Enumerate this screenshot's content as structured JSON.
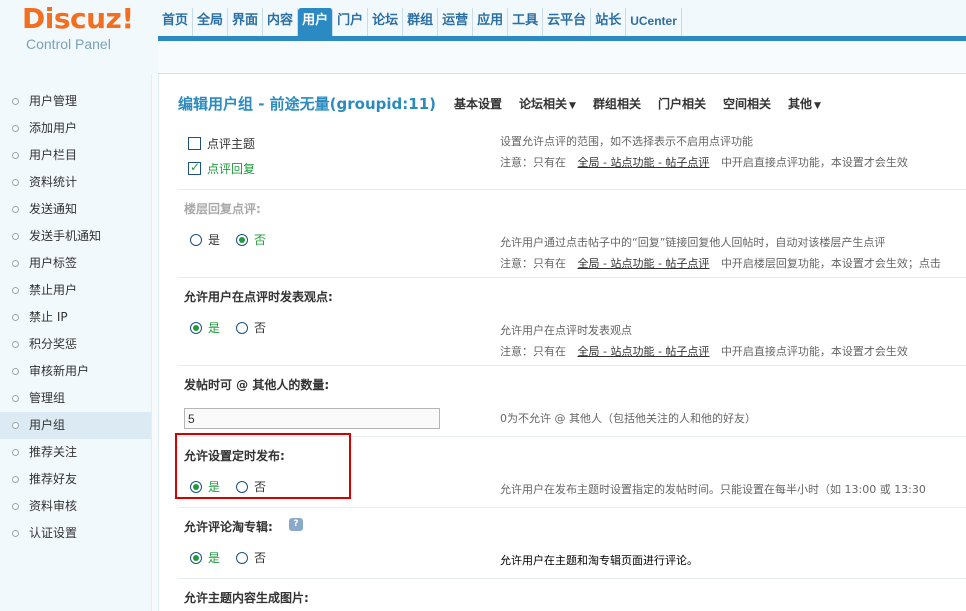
{
  "logo": {
    "brand": "Discuz!",
    "subtitle": "Control Panel"
  },
  "topnav": [
    "首页",
    "全局",
    "界面",
    "内容",
    "用户",
    "门户",
    "论坛",
    "群组",
    "运营",
    "应用",
    "工具",
    "云平台",
    "站长",
    "UCenter"
  ],
  "topnav_active": "用户",
  "sidebar": {
    "items": [
      "用户管理",
      "添加用户",
      "用户栏目",
      "资料统计",
      "发送通知",
      "发送手机通知",
      "用户标签",
      "禁止用户",
      "禁止 IP",
      "积分奖惩",
      "审核新用户",
      "管理组",
      "用户组",
      "推荐关注",
      "推荐好友",
      "资料审核",
      "认证设置"
    ],
    "active": "用户组"
  },
  "page": {
    "title": "编辑用户组 - 前途无量(groupid:11)",
    "tabs": [
      {
        "label": "基本设置",
        "dropdown": false
      },
      {
        "label": "论坛相关",
        "dropdown": true
      },
      {
        "label": "群组相关",
        "dropdown": false
      },
      {
        "label": "门户相关",
        "dropdown": false
      },
      {
        "label": "空间相关",
        "dropdown": false
      },
      {
        "label": "其他",
        "dropdown": true
      }
    ]
  },
  "settings": {
    "comment_scope": {
      "options": [
        {
          "label": "点评主题",
          "checked": false
        },
        {
          "label": "点评回复",
          "checked": true
        }
      ],
      "desc1": "设置允许点评的范围，如不选择表示不启用点评功能",
      "desc2_prefix": "注意：只有在",
      "desc2_link": "全局 - 站点功能 - 帖子点评",
      "desc2_suffix": "中开启直接点评功能，本设置才会生效"
    },
    "floor_reply": {
      "label": "楼层回复点评:",
      "yes": "是",
      "no": "否",
      "value": "no",
      "desc1": "允许用户通过点击帖子中的“回复”链接回复他人回帖时，自动对该楼层产生点评",
      "desc2_prefix": "注意：只有在",
      "desc2_link": "全局 - 站点功能 - 帖子点评",
      "desc2_suffix": "中开启楼层回复功能，本设置才会生效；点击"
    },
    "comment_opinion": {
      "label": "允许用户在点评时发表观点:",
      "yes": "是",
      "no": "否",
      "value": "yes",
      "desc1": "允许用户在点评时发表观点",
      "desc2_prefix": "注意：只有在",
      "desc2_link": "全局 - 站点功能 - 帖子点评",
      "desc2_suffix": "中开启直接点评功能，本设置才会生效"
    },
    "mention_count": {
      "label": "发帖时可 @ 其他人的数量:",
      "value": "5",
      "desc": "0为不允许 @ 其他人（包括他关注的人和他的好友）"
    },
    "scheduled_post": {
      "label": "允许设置定时发布:",
      "yes": "是",
      "no": "否",
      "value": "yes",
      "desc": "允许用户在发布主题时设置指定的发帖时间。只能设置在每半小时（如 13:00 或 13:30"
    },
    "album_comment": {
      "label": "允许评论淘专辑:",
      "help_icon": "help-icon",
      "yes": "是",
      "no": "否",
      "value": "yes",
      "desc": "允许用户在主题和淘专辑页面进行评论。"
    },
    "content_image": {
      "label": "允许主题内容生成图片:"
    }
  },
  "colors": {
    "brand": "#f36f20",
    "nav_active": "#2b89c3",
    "title": "#2b8bbf",
    "checked": "#1f9a3c",
    "highlight": "#d60000"
  }
}
